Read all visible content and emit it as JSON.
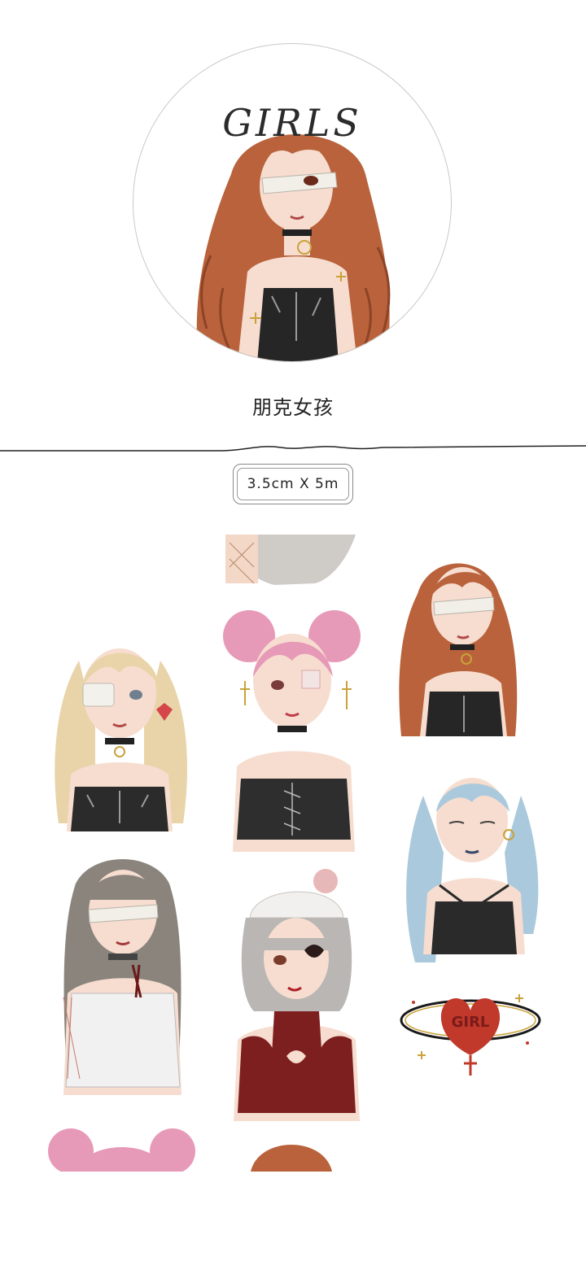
{
  "roll_title": "GIRLS",
  "product_name": "朋克女孩",
  "spec": "3.5cm X 5m",
  "stickers": [
    {
      "id": "blonde-twin-tails-girl",
      "hair": "#e8d4a8",
      "top": "#2b2b2b"
    },
    {
      "id": "pink-buns-girl",
      "hair": "#e79ab8",
      "top": "#2e2e2e"
    },
    {
      "id": "auburn-wavy-girl",
      "hair": "#b9623b",
      "top": "#262626"
    },
    {
      "id": "blue-braids-girl",
      "hair": "#aac9dc",
      "top": "#2a2a2a"
    },
    {
      "id": "gray-hair-girl",
      "hair": "#8a847c",
      "top": "#f1f1f1"
    },
    {
      "id": "silver-bob-girl",
      "hair": "#b9b6b3",
      "top": "#7e1f1f"
    },
    {
      "id": "girl-heart-emblem",
      "accent": "#c0392b",
      "gold": "#c9a23a"
    }
  ],
  "colors": {
    "skin": "#f6ddcf",
    "gold": "#c9a23a",
    "line": "#3a3a3a"
  }
}
